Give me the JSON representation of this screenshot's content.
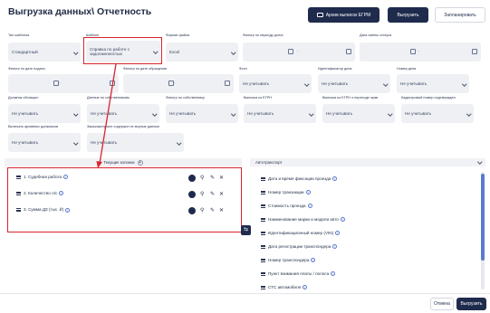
{
  "header": {
    "title": "Выгрузка данных\\ Отчетность",
    "archive_button": "Архив выписок ЕГРМ",
    "export_button": "Выгрузить",
    "schedule_button": "Запланировать"
  },
  "filters": {
    "template_type": {
      "label": "Тип шаблона",
      "value": "Стандартный"
    },
    "template": {
      "label": "Шаблон",
      "value_line1": "Справка по работе с",
      "value_line2": "задолженностью"
    },
    "file_format": {
      "label": "Формат файла",
      "value": "Excel"
    },
    "debt_period": {
      "label": "Фильтр по периоду долга",
      "from_placeholder": "",
      "to_placeholder": ""
    },
    "status_date": {
      "label": "Дата смены статуса",
      "from_placeholder": "",
      "to_placeholder": ""
    },
    "filing_date": {
      "label": "Фильтр по дате подачи"
    },
    "case_date": {
      "label": "Фильтр по дате обращения"
    },
    "fssp": {
      "label": "Фссп",
      "value": "Не учитывать"
    },
    "case_id": {
      "label": "Идентификатор дела",
      "value": "Не учитывать"
    },
    "case_number": {
      "label": "Номер дела",
      "value": "Не учитывать"
    },
    "debtor_role": {
      "label": "Должник обогащен",
      "value": "Не учитывать"
    },
    "owner_data": {
      "label": "Данные по собственникам",
      "value": "Не учитывать"
    },
    "owner_filter": {
      "label": "Фильтр по собственнику",
      "value": "Не учитывать"
    },
    "egrn_extract": {
      "label": "Выписка из ЕГРН",
      "value": "Не учитывать"
    },
    "egrn_extract_rights": {
      "label": "Выписка из ЕГРН о переходе прав",
      "value": "Не учитывать"
    },
    "cadastral": {
      "label": "Кадастровый номер подтвержден",
      "value": "Не учитывать"
    },
    "include_archive": {
      "label": "Включать архивных должников",
      "value": "Не учитывать"
    },
    "order_contains": {
      "label": "Заказчик/проект содержит не верные данные",
      "value": "Не учитывать"
    }
  },
  "left_panel": {
    "header": "Текущие колонки",
    "items": [
      {
        "label": "1. Судебная работа"
      },
      {
        "label": "2. Количество л/с"
      },
      {
        "label": "3. Сумма ДЗ (тыс. ₽)"
      }
    ]
  },
  "right_panel": {
    "header": "Автотранспорт",
    "items": [
      {
        "label": "Дата и время фиксации проезда"
      },
      {
        "label": "Номер транзакции"
      },
      {
        "label": "Стоимость проезда"
      },
      {
        "label": "Наименование марки и модели авто"
      },
      {
        "label": "Идентификационный номер (VIN)"
      },
      {
        "label": "Дата регистрации транспондера"
      },
      {
        "label": "Номер транспондера"
      },
      {
        "label": "Пункт взимания платы / полоса"
      },
      {
        "label": "СТС автомобиля"
      }
    ]
  },
  "footer": {
    "cancel_button": "Отмена",
    "export_button": "Выгрузить"
  },
  "colors": {
    "primary": "#1f2b4d",
    "highlight": "#d9232d",
    "field_bg": "#eef0f4",
    "info": "#5a7bd0"
  }
}
